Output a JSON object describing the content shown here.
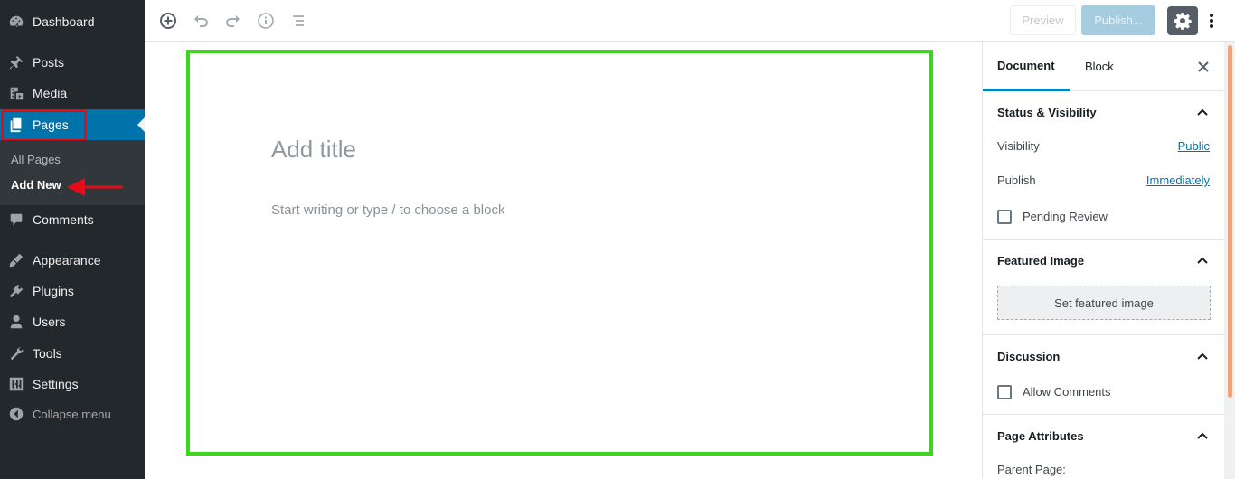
{
  "admin_menu": {
    "items": [
      {
        "label": "Dashboard",
        "icon": "dashboard-icon"
      },
      {
        "label": "Posts",
        "icon": "pushpin-icon"
      },
      {
        "label": "Media",
        "icon": "media-icon"
      },
      {
        "label": "Pages",
        "icon": "pages-icon"
      },
      {
        "label": "Comments",
        "icon": "comment-icon"
      },
      {
        "label": "Appearance",
        "icon": "brush-icon"
      },
      {
        "label": "Plugins",
        "icon": "plugin-icon"
      },
      {
        "label": "Users",
        "icon": "user-icon"
      },
      {
        "label": "Tools",
        "icon": "wrench-icon"
      },
      {
        "label": "Settings",
        "icon": "sliders-icon"
      }
    ],
    "submenu": [
      {
        "label": "All Pages"
      },
      {
        "label": "Add New"
      }
    ],
    "collapse_label": "Collapse menu"
  },
  "toolbar": {
    "preview_label": "Preview",
    "publish_label": "Publish..."
  },
  "editor": {
    "title_placeholder": "Add title",
    "body_placeholder": "Start writing or type / to choose a block"
  },
  "sidebar": {
    "tabs": [
      "Document",
      "Block"
    ],
    "status": {
      "title": "Status & Visibility",
      "visibility_label": "Visibility",
      "visibility_value": "Public",
      "publish_label": "Publish",
      "publish_value": "Immediately",
      "pending_label": "Pending Review"
    },
    "featured": {
      "title": "Featured Image",
      "button": "Set featured image"
    },
    "discussion": {
      "title": "Discussion",
      "allow_comments": "Allow Comments"
    },
    "attributes": {
      "title": "Page Attributes",
      "parent_label": "Parent Page:"
    }
  },
  "colors": {
    "admin_bg": "#23282d",
    "accent": "#0073aa",
    "highlight_red": "#e40c18",
    "frame_green": "#3dd61e"
  }
}
